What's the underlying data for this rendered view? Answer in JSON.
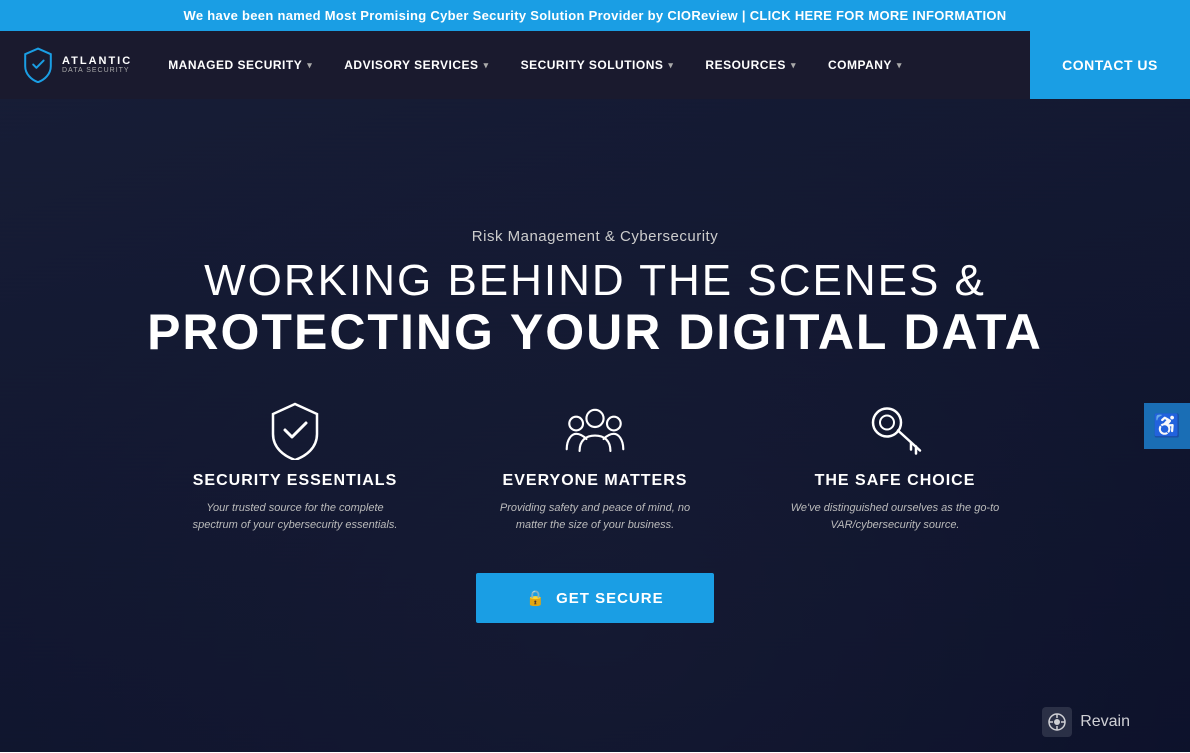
{
  "banner": {
    "text": "We have been named Most Promising Cyber Security Solution Provider by CIOReview | CLICK HERE FOR MORE INFORMATION"
  },
  "navbar": {
    "logo": {
      "top_word": "AtlaNtIC",
      "bottom_words": "Data Security"
    },
    "items": [
      {
        "label": "MANAGED SECURITY",
        "has_dropdown": true
      },
      {
        "label": "ADVISORY SERVICES",
        "has_dropdown": true
      },
      {
        "label": "SECURITY SOLUTIONS",
        "has_dropdown": true
      },
      {
        "label": "RESOURCES",
        "has_dropdown": true
      },
      {
        "label": "COMPANY",
        "has_dropdown": true
      }
    ],
    "contact_label": "CONTACT US"
  },
  "hero": {
    "subtitle": "Risk Management & Cybersecurity",
    "title_line1": "WORKING BEHIND THE SCENES &",
    "title_line2": "PROTECTING YOUR DIGITAL DATA",
    "features": [
      {
        "icon": "shield-check",
        "title": "SECURITY ESSENTIALS",
        "desc": "Your trusted source for the complete spectrum of your cybersecurity essentials."
      },
      {
        "icon": "group",
        "title": "EVERYONE MATTERS",
        "desc": "Providing safety and peace of mind, no matter the size of your business."
      },
      {
        "icon": "key",
        "title": "THE SAFE CHOICE",
        "desc": "We've distinguished ourselves as the go-to VAR/cybersecurity source."
      }
    ],
    "cta_label": "GET SECURE"
  },
  "accessibility": {
    "label": "♿"
  },
  "revain": {
    "label": "Revain"
  }
}
